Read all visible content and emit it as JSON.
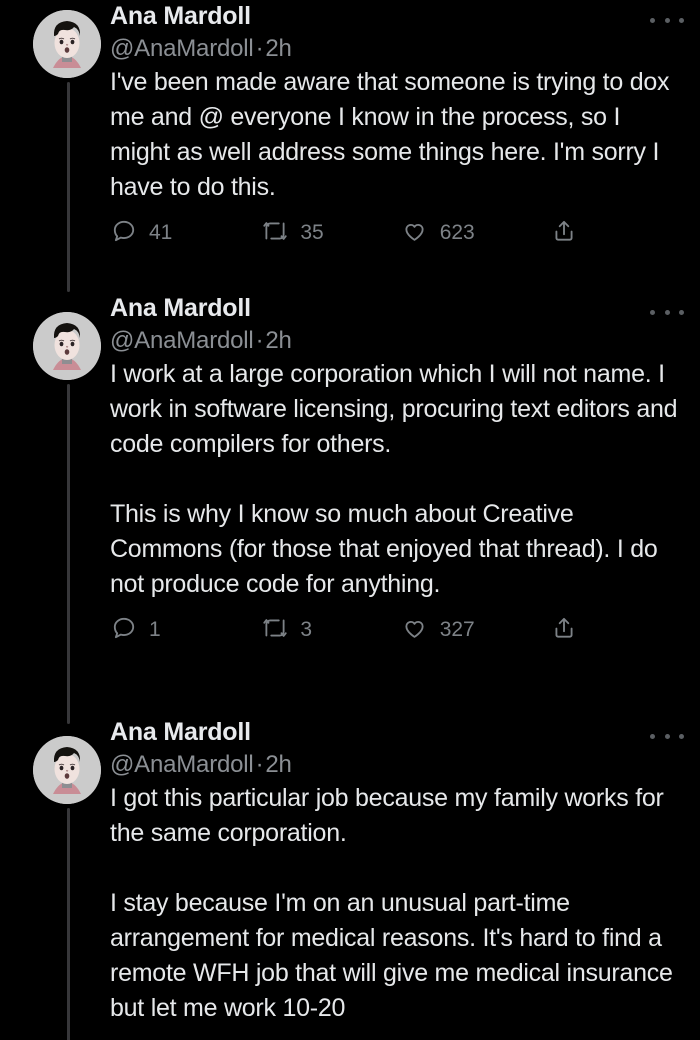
{
  "theme": {
    "background": "#000000",
    "text_primary": "#e6e8ea",
    "text_secondary": "#8b8f94",
    "action_color": "#7d8287",
    "thread_line": "#37373a",
    "avatar_background": "#cfcfcf"
  },
  "author": {
    "display_name": "Ana Mardoll",
    "handle": "@AnaMardoll",
    "separator": "·",
    "timestamp": "2h",
    "avatar_alt": "illustrated portrait of person with curly dark hair and pink top"
  },
  "icons": {
    "more": "more-options-icon",
    "reply": "reply-icon",
    "retweet": "retweet-icon",
    "like": "like-heart-icon",
    "share": "share-icon"
  },
  "tweets": [
    {
      "id": "tweet-1",
      "text": "I've been made aware that someone is trying to dox me and @ everyone I know in the process, so I might as well address some things here. I'm sorry I have to do this.",
      "actions": {
        "reply_count": "41",
        "retweet_count": "35",
        "like_count": "623",
        "share_count": ""
      }
    },
    {
      "id": "tweet-2",
      "text": "I work at a large corporation which I will not name. I work in software licensing, procuring text editors and code compilers for others.\n\nThis is why I know so much about Creative Commons (for those that enjoyed that thread). I do not produce code for anything.",
      "actions": {
        "reply_count": "1",
        "retweet_count": "3",
        "like_count": "327",
        "share_count": ""
      }
    },
    {
      "id": "tweet-3",
      "text": "I got this particular job because my family works for the same corporation.\n\nI stay because I'm on an unusual part-time arrangement for medical reasons. It's hard to find a remote WFH job that will give me medical insurance but let me work 10-20",
      "actions": {
        "reply_count": "",
        "retweet_count": "",
        "like_count": "",
        "share_count": ""
      }
    }
  ]
}
